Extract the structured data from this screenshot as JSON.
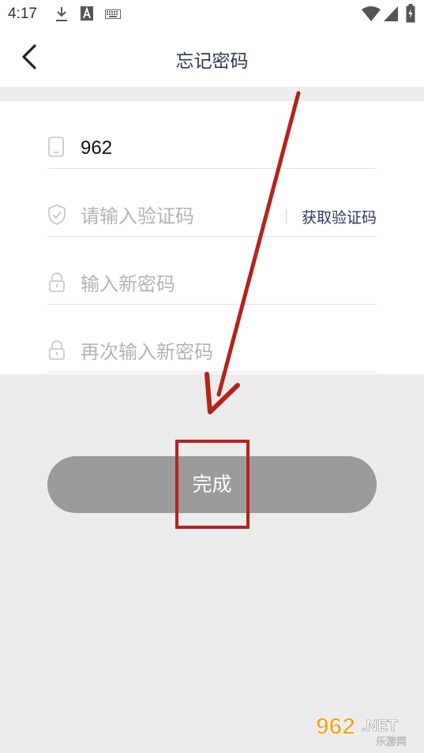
{
  "status_bar": {
    "time": "4:17",
    "icons": [
      "download-icon",
      "text-a-icon",
      "keyboard-icon",
      "wifi-icon",
      "signal-icon",
      "battery-icon"
    ]
  },
  "header": {
    "title": "忘记密码",
    "back_icon": "chevron-left-icon"
  },
  "form": {
    "phone": {
      "icon": "phone-icon",
      "value": "962"
    },
    "code": {
      "icon": "shield-check-icon",
      "placeholder": "请输入验证码",
      "get_code_label": "获取验证码"
    },
    "new_password": {
      "icon": "lock-icon",
      "placeholder": "输入新密码"
    },
    "confirm_password": {
      "icon": "lock-icon",
      "placeholder": "再次输入新密码"
    }
  },
  "actions": {
    "done_label": "完成"
  },
  "annotation": {
    "arrow_color": "#b5231c",
    "box_color": "#b5231c"
  },
  "watermark": {
    "brand": "962",
    "suffix": ".NET",
    "subtitle": "乐游网"
  },
  "colors": {
    "title": "#2b3a55",
    "link": "#2b3a66",
    "button_disabled": "#9b9b9b",
    "placeholder": "#b4b4b4",
    "background": "#ececec"
  }
}
